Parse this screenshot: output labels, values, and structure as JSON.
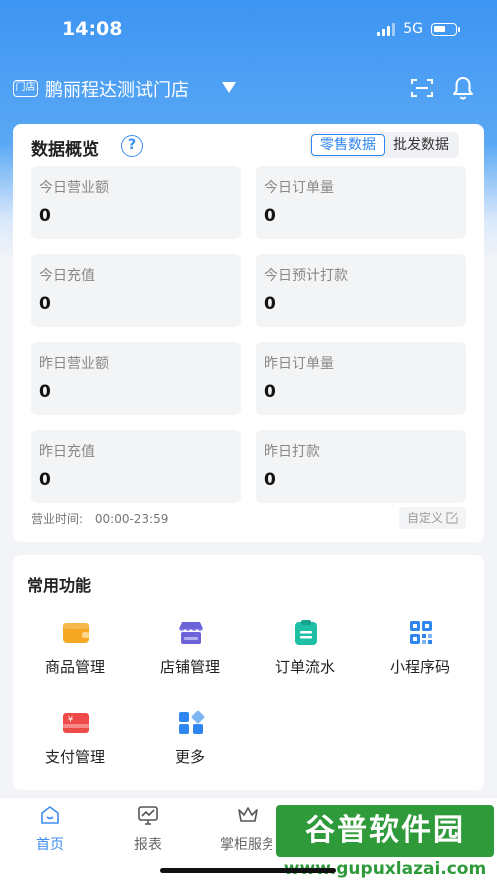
{
  "status_bar": {
    "time": "14:08",
    "network": "5G"
  },
  "header": {
    "store_tag": "门店",
    "store_name": "鹏丽程达测试门店"
  },
  "overview": {
    "title": "数据概览",
    "help_symbol": "?",
    "tabs": [
      {
        "label": "零售数据",
        "active": true
      },
      {
        "label": "批发数据",
        "active": false
      }
    ],
    "stats": [
      {
        "label": "今日营业额",
        "value": "0"
      },
      {
        "label": "今日订单量",
        "value": "0"
      },
      {
        "label": "今日充值",
        "value": "0"
      },
      {
        "label": "今日预计打款",
        "value": "0"
      },
      {
        "label": "昨日营业额",
        "value": "0"
      },
      {
        "label": "昨日订单量",
        "value": "0"
      },
      {
        "label": "昨日充值",
        "value": "0"
      },
      {
        "label": "昨日打款",
        "value": "0"
      }
    ],
    "business_hours_label": "营业时间:",
    "business_hours": "00:00-23:59",
    "custom_label": "自定义"
  },
  "functions": {
    "title": "常用功能",
    "items": [
      {
        "label": "商品管理",
        "icon": "wallet-icon",
        "color": "#f5a623"
      },
      {
        "label": "店铺管理",
        "icon": "shop-icon",
        "color": "#6c63d9"
      },
      {
        "label": "订单流水",
        "icon": "clipboard-icon",
        "color": "#1ebfa5"
      },
      {
        "label": "小程序码",
        "icon": "qrcode-icon",
        "color": "#2f86ee"
      },
      {
        "label": "支付管理",
        "icon": "card-icon",
        "color": "#ee4a4a"
      },
      {
        "label": "更多",
        "icon": "grid-icon",
        "color": "#2f86ee"
      }
    ]
  },
  "tabbar": {
    "items": [
      {
        "label": "首页",
        "icon": "home-icon",
        "active": true
      },
      {
        "label": "报表",
        "icon": "chart-icon",
        "active": false
      },
      {
        "label": "掌柜服务",
        "icon": "crown-icon",
        "active": false
      }
    ]
  },
  "watermark": {
    "brand": "谷普软件园",
    "url": "www.gupuxlazai.com"
  },
  "colors": {
    "accent": "#3d8ef0",
    "header_bg": "#3d95f2"
  }
}
